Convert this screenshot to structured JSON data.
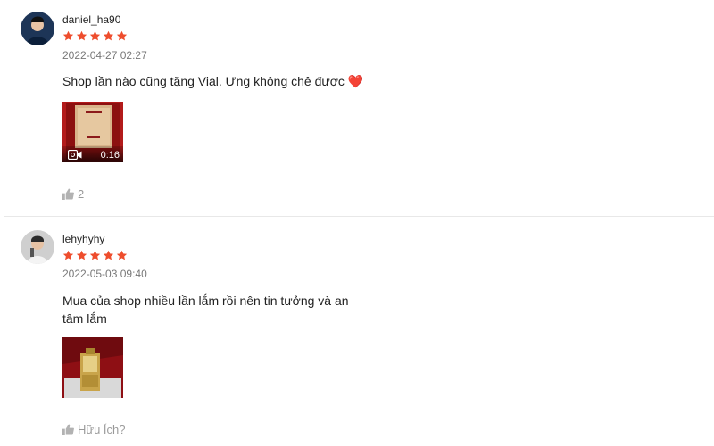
{
  "reviews": [
    {
      "username": "daniel_ha90",
      "rating": 5,
      "timestamp": "2022-04-27 02:27",
      "comment": "Shop lần nào cũng tặng Vial. Ưng không chê được ❤️",
      "video_duration": "0:16",
      "like_text": "2",
      "avatar_icon": "avatar-icon",
      "media_type": "video"
    },
    {
      "username": "lehyhyhy",
      "rating": 5,
      "timestamp": "2022-05-03 09:40",
      "comment": "Mua của shop nhiều lần lắm rồi nên tin tưởng và an tâm lắm",
      "like_text": "Hữu Ích?",
      "avatar_icon": "avatar-icon",
      "media_type": "image"
    }
  ],
  "colors": {
    "star": "#ee4d2d",
    "muted": "#757575",
    "divider": "#e8e8e8"
  }
}
